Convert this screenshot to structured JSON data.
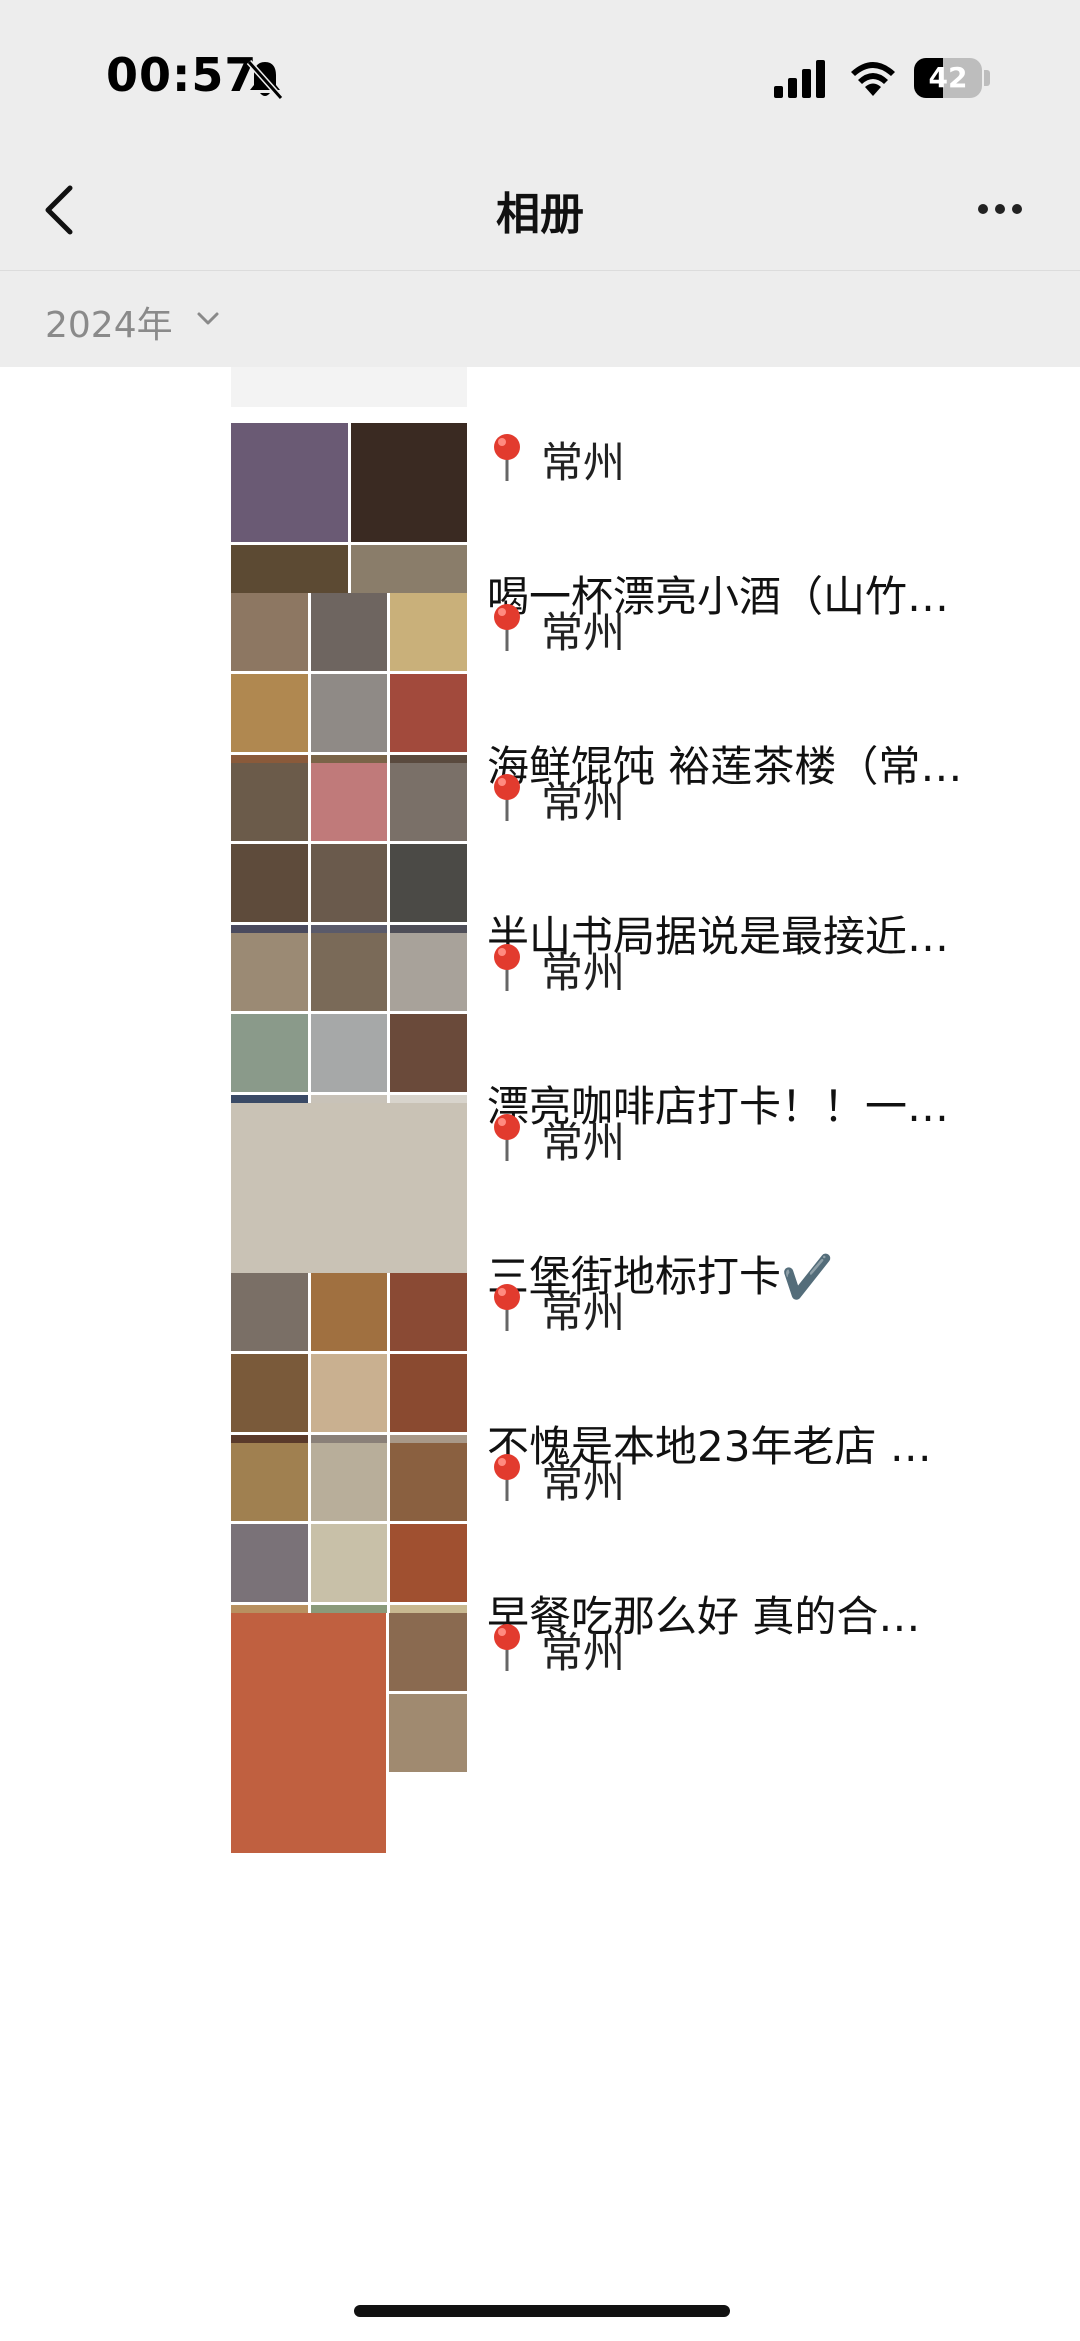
{
  "status_bar": {
    "time": "00:57",
    "battery_level": "42",
    "battery_fraction": 0.42
  },
  "nav": {
    "title": "相册",
    "back_icon": "chevron-left-icon",
    "more_icon": "ellipsis-icon"
  },
  "filter": {
    "year": "2024年",
    "icon": "chevron-down-icon"
  },
  "colors": {
    "chrome_bg": "#ededed",
    "pin_red": "#e23b2e",
    "text": "#111111",
    "muted": "#8a8a8a"
  },
  "posts": [
    {
      "location": "常州",
      "caption": "喝一杯漂亮小酒（山竹…",
      "photo_count": 4,
      "tiles": [
        "#6a5a74",
        "#3a2a22",
        "#5c4a33",
        "#8a7d6a"
      ]
    },
    {
      "location": "常州",
      "caption": "海鲜馄饨 裕莲茶楼（常…",
      "photo_count": 9,
      "tiles": [
        "#8d7762",
        "#6e6560",
        "#c9b07a",
        "#b08850",
        "#8f8a86",
        "#a24a3c",
        "#8a5a3a",
        "#7a6448",
        "#5a4a3e"
      ]
    },
    {
      "location": "常州",
      "caption": "半山书局据说是最接近…",
      "photo_count": 9,
      "tiles": [
        "#6b5b4a",
        "#c07a7a",
        "#7a7068",
        "#5e4b3b",
        "#6a5a4c",
        "#4b4a46",
        "#4a4a5e",
        "#5a5a6a",
        "#4e4e58"
      ]
    },
    {
      "location": "常州",
      "caption": "漂亮咖啡店打卡！！一…",
      "photo_count": 9,
      "tiles": [
        "#9b8a74",
        "#7a6a58",
        "#a8a29a",
        "#8a9a8a",
        "#a6a8a8",
        "#6a4a3a",
        "#3a4a66",
        "#c8c2b8",
        "#d8d4cc"
      ]
    },
    {
      "location": "常州",
      "caption": "三堡街地标打卡✔️",
      "photo_count": 1,
      "tiles": [
        "#c9c2b5"
      ]
    },
    {
      "location": "常州",
      "caption": "不愧是本地23年老店 …",
      "photo_count": 9,
      "tiles": [
        "#7a6f66",
        "#a07040",
        "#8a4a34",
        "#7a5a3a",
        "#c9b090",
        "#8a4a30",
        "#5a3a2a",
        "#8a8078",
        "#a89888"
      ]
    },
    {
      "location": "常州",
      "caption": "早餐吃那么好 真的合…",
      "photo_count": 9,
      "tiles": [
        "#a08050",
        "#b8ae9a",
        "#8a6040",
        "#7a7278",
        "#c8c0a8",
        "#a05030",
        "#b89060",
        "#8a9a7a",
        "#c8b890"
      ]
    },
    {
      "location": "常州",
      "caption": "",
      "photo_count": 3,
      "tiles": [
        "#c06040",
        "#8a6a50",
        "#a08a70"
      ]
    }
  ]
}
